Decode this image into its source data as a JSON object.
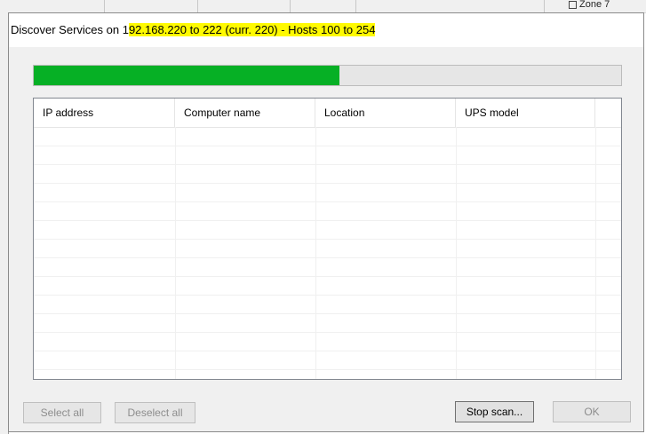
{
  "dialog": {
    "title_prefix": "Discover Services on 1",
    "title_highlight": "92.168.220 to 222 (curr. 220) - Hosts 100 to 254"
  },
  "background": {
    "zone_label": "Zone 7"
  },
  "progress": {
    "fraction": 0.52,
    "fill_color": "#06b025"
  },
  "table": {
    "columns": [
      "IP address",
      "Computer name",
      "Location",
      "UPS model"
    ],
    "rows": []
  },
  "buttons": {
    "select_all": "Select all",
    "deselect_all": "Deselect all",
    "stop_scan": "Stop scan...",
    "ok": "OK"
  }
}
